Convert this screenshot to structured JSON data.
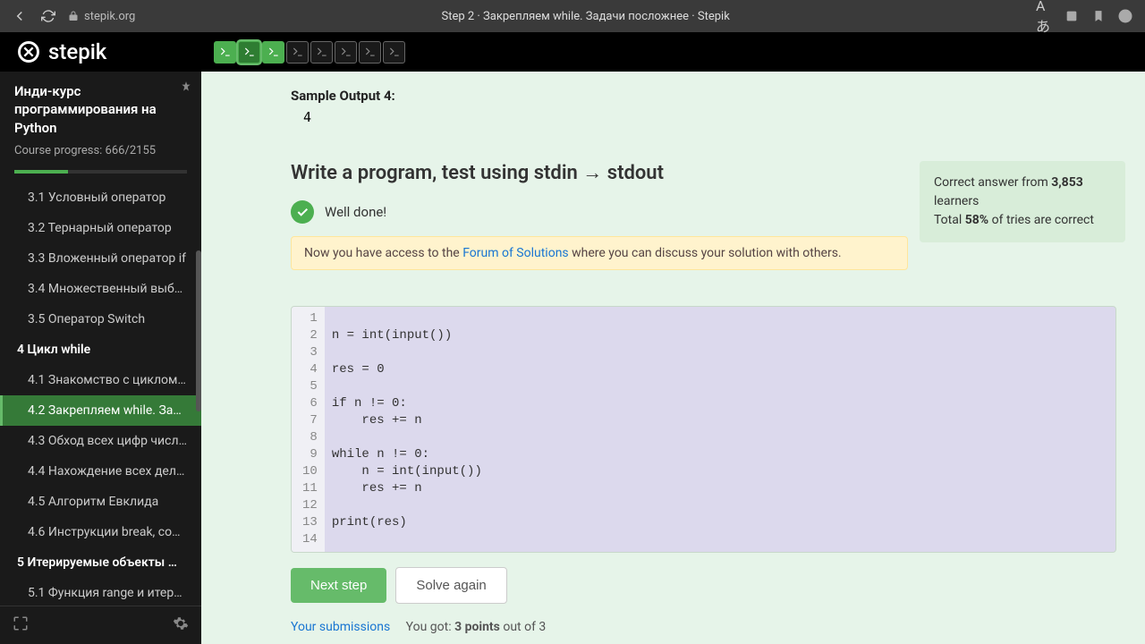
{
  "browser": {
    "url": "stepik.org",
    "title": "Step 2 · Закрепляем while. Задачи посложнее · Stepik"
  },
  "logo_text": "stepik",
  "sidebar": {
    "course_title": "Инди-курс программирования на Python",
    "progress_label": "Course progress:",
    "progress_value": "666/2155",
    "items": [
      {
        "label": "3.1  Условный оператор",
        "type": "item"
      },
      {
        "label": "3.2  Тернарный оператор",
        "type": "item"
      },
      {
        "label": "3.3  Вложенный оператор if",
        "type": "item"
      },
      {
        "label": "3.4  Множественный выбо…",
        "type": "item"
      },
      {
        "label": "3.5  Оператор Switch",
        "type": "item"
      },
      {
        "label": "4  Цикл while",
        "type": "section"
      },
      {
        "label": "4.1  Знакомство с циклом …",
        "type": "item"
      },
      {
        "label": "4.2  Закрепляем while. Зад…",
        "type": "item",
        "active": true
      },
      {
        "label": "4.3  Обход всех цифр числа…",
        "type": "item"
      },
      {
        "label": "4.4  Нахождение всех дели…",
        "type": "item"
      },
      {
        "label": "4.5  Алгоритм Евклида",
        "type": "item"
      },
      {
        "label": "4.6  Инструкции break, conti…",
        "type": "item"
      },
      {
        "label": "5  Итерируемые объекты …",
        "type": "section"
      },
      {
        "label": "5.1  Функция range и итери…",
        "type": "item"
      }
    ]
  },
  "content": {
    "sample_output_label": "Sample Output 4:",
    "sample_output_value": "4",
    "task_title": "Write a program, test using stdin → stdout",
    "well_done": "Well done!",
    "forum_pre": "Now you have access to the ",
    "forum_link": "Forum of Solutions",
    "forum_post": " where you can discuss your solution with others.",
    "stats_line1_pre": "Correct answer from ",
    "stats_line1_bold": "3,853",
    "stats_line1_post": " learners",
    "stats_line2_pre": "Total ",
    "stats_line2_bold": "58%",
    "stats_line2_post": " of tries are correct",
    "code_lines": [
      "",
      "n = int(input())",
      "",
      "res = 0",
      "",
      "if n != 0:",
      "    res += n",
      "",
      "while n != 0:",
      "    n = int(input())",
      "    res += n",
      "",
      "print(res)",
      ""
    ],
    "next_step": "Next step",
    "solve_again": "Solve again",
    "submissions_link": "Your submissions",
    "got_pre": "You got: ",
    "got_bold": "3 points",
    "got_post": " out of 3"
  },
  "step_tabs_count": 8,
  "solved_tabs": 3,
  "active_tab_index": 1
}
